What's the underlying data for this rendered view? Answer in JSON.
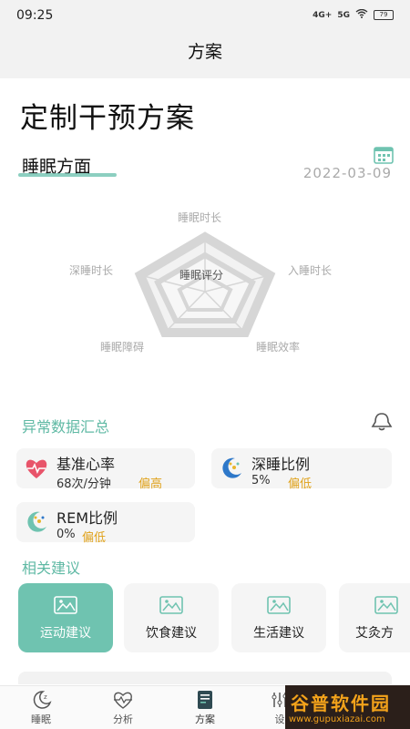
{
  "status_bar": {
    "time": "09:25",
    "signal1": "4G+",
    "signal2": "5G",
    "battery": "79"
  },
  "header": {
    "title": "方案"
  },
  "page": {
    "title": "定制干预方案",
    "section": "睡眠方面",
    "date": "2022-03-09"
  },
  "radar": {
    "center_label": "睡眠评分",
    "axes": [
      "睡眠时长",
      "入睡时长",
      "睡眠效率",
      "睡眠障碍",
      "深睡时长"
    ]
  },
  "anomaly": {
    "title": "异常数据汇总",
    "metrics": [
      {
        "name": "基准心率",
        "value": "68次/分钟",
        "status": "偏高",
        "icon": "heart-rate-icon"
      },
      {
        "name": "深睡比例",
        "value": "5%",
        "status": "偏低",
        "icon": "moon-sleep-icon"
      },
      {
        "name": "REM比例",
        "value": "0%",
        "status": "偏低",
        "icon": "moon-sleep-icon"
      }
    ]
  },
  "advice": {
    "title": "相关建议",
    "items": [
      {
        "label": "运动建议",
        "active": true
      },
      {
        "label": "饮食建议",
        "active": false
      },
      {
        "label": "生活建议",
        "active": false
      },
      {
        "label": "艾灸方",
        "active": false
      }
    ]
  },
  "tabbar": {
    "items": [
      {
        "label": "睡眠",
        "icon": "moon-icon"
      },
      {
        "label": "分析",
        "icon": "heartbeat-icon"
      },
      {
        "label": "方案",
        "icon": "document-icon",
        "active": true
      },
      {
        "label": "设",
        "icon": "settings-icon"
      }
    ]
  },
  "watermark": {
    "main": "谷普软件园",
    "url": "www.gupuxiazai.com"
  },
  "colors": {
    "accent": "#6fc3b0",
    "accent_text": "#5fb9a4",
    "warning": "#e0a21a",
    "heart": "#e8546a",
    "moon_blue": "#2e78c9"
  }
}
